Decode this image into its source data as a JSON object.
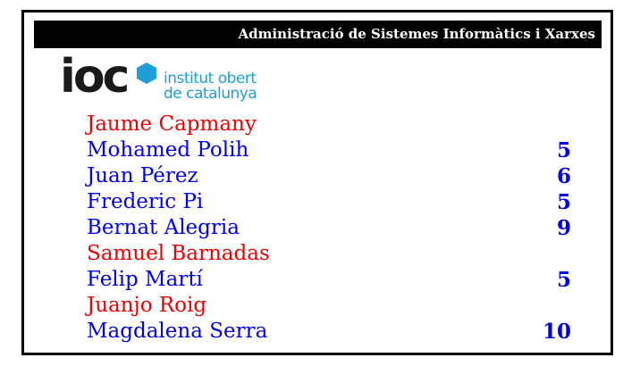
{
  "header": {
    "title": "Administració de Sistemes Informàtics i Xarxes"
  },
  "logo": {
    "short": "ioc",
    "line1": "institut obert",
    "line2": "de catalunya",
    "accent_color": "#1e9fd8"
  },
  "colors": {
    "name_red": "#ee0000",
    "name_blue": "#0000ee"
  },
  "students": [
    {
      "name": "Jaume Capmany",
      "grade": "",
      "color": "red"
    },
    {
      "name": "Mohamed Polih",
      "grade": "5",
      "color": "blue"
    },
    {
      "name": "Juan Pérez",
      "grade": "6",
      "color": "blue"
    },
    {
      "name": "Frederic Pi",
      "grade": "5",
      "color": "blue"
    },
    {
      "name": "Bernat Alegria",
      "grade": "9",
      "color": "blue"
    },
    {
      "name": "Samuel Barnadas",
      "grade": "",
      "color": "red"
    },
    {
      "name": "Felip Martí",
      "grade": "5",
      "color": "blue"
    },
    {
      "name": "Juanjo Roig",
      "grade": "",
      "color": "red"
    },
    {
      "name": "Magdalena Serra",
      "grade": "10",
      "color": "blue"
    }
  ]
}
